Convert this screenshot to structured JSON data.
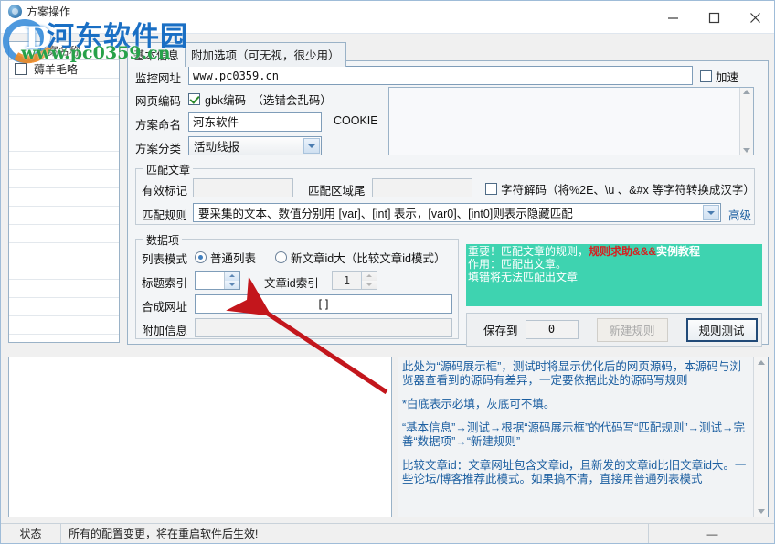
{
  "window": {
    "title": "方案操作",
    "minimize_label": "minimize",
    "maximize_label": "maximize",
    "close_label": "close"
  },
  "watermark": {
    "brand": "河东软件园",
    "url": "www.pc0359.cn",
    "mark": "D"
  },
  "plan_list": {
    "header": "方案名称",
    "rows": [
      {
        "label": "薅羊毛咯",
        "checked": false
      }
    ]
  },
  "tabs": [
    {
      "label": "基本信息",
      "active": true
    },
    {
      "label": "附加选项（可无视，很少用）",
      "active": false
    }
  ],
  "basic": {
    "monitor_url_label": "监控网址",
    "monitor_url_value": "www.pc0359.cn",
    "accel_label": "加速",
    "accel_checked": false,
    "encoding_label": "网页编码",
    "encoding_checkbox_label": "gbk编码　（选错会乱码）",
    "encoding_checked": true,
    "plan_name_label": "方案命名",
    "plan_name_value": "河东软件",
    "plan_category_label": "方案分类",
    "plan_category_value": "活动线报",
    "cookie_label": "COOKIE",
    "cookie_value": ""
  },
  "match_article": {
    "group_title": "匹配文章",
    "valid_mark_label": "有效标记",
    "valid_mark_value": "",
    "region_tail_label": "匹配区域尾",
    "region_tail_value": "",
    "decode_label": "字符解码（将%2E、\\u 、&#x 等字符转换成汉字）",
    "decode_checked": false,
    "rule_label": "匹配规则",
    "rule_value": "要采集的文本、数值分别用 [var]、[int] 表示，[var0]、[int0]则表示隐藏匹配",
    "advanced_link": "高级"
  },
  "data_items": {
    "group_title": "数据项",
    "list_mode_label": "列表模式",
    "mode_normal_label": "普通列表",
    "mode_normal_selected": true,
    "mode_newid_label": "新文章id大（比较文章id模式）",
    "mode_newid_selected": false,
    "title_index_label": "标题索引",
    "title_index_value": "",
    "article_id_index_label": "文章id索引",
    "article_id_index_value": "1",
    "compose_url_label": "合成网址",
    "compose_url_value": "[]",
    "extra_info_label": "附加信息",
    "extra_info_value": ""
  },
  "help_green": {
    "line1_prefix": "重要！匹配文章的规则，",
    "line1_red": "规则求助",
    "line1_sep": "&&&",
    "line1_suffix": "实例教程",
    "line2": "作用：匹配出文章。",
    "line3": "填错将无法匹配出文章"
  },
  "action_bar": {
    "save_to_label": "保存到",
    "save_to_value": "0",
    "new_rule_label": "新建规则",
    "new_rule_disabled": true,
    "rule_test_label": "规则测试"
  },
  "source_box": {
    "value": ""
  },
  "help_text": {
    "p1": "此处为“源码展示框”，测试时将显示优化后的网页源码，本源码与浏览器查看到的源码有差异，一定要依据此处的源码写规则",
    "p2": "*白底表示必填，灰底可不填。",
    "p3": "“基本信息”→测试→根据“源码展示框”的代码写“匹配规则”→测试→完善“数据项”→“新建规则”",
    "p4": "比较文章id：文章网址包含文章id，且新发的文章id比旧文章id大。一些论坛/博客推荐此模式。如果搞不清，直接用普通列表模式"
  },
  "status_bar": {
    "label": "状态",
    "message": "所有的配置变更，将在重启软件后生效!",
    "right_cell": "—"
  },
  "colors": {
    "green_panel": "#3ed3b0",
    "help_text": "#1b5ea0",
    "link": "#1b5ea0",
    "accent_red": "#d62121",
    "arrow_red": "#c3161c",
    "brand_blue": "#1a6fc4",
    "brand_green": "#27a14a"
  }
}
